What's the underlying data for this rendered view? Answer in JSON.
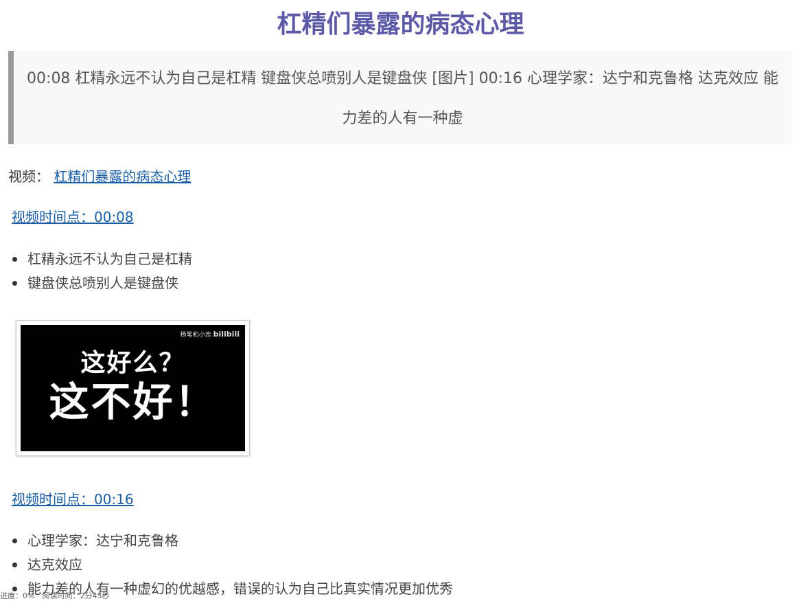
{
  "article": {
    "title": "杠精们暴露的病态心理",
    "summary": "00:08 杠精永远不认为自己是杠精 键盘侠总喷别人是键盘侠 [图片] 00:16 心理学家：达宁和克鲁格 达克效应 能力差的人有一种虚",
    "video_label": "视频：",
    "video_link": "杠精们暴露的病态心理"
  },
  "sections": [
    {
      "timestamp_link": "视频时间点：00:08",
      "bullets": [
        "杠精永远不认为自己是杠精",
        "键盘侠总喷别人是键盘侠"
      ],
      "thumbnail": {
        "line1": "这好么？",
        "line2": "这不好！",
        "watermark": "杨笔和小忠",
        "logo": "bilibili"
      }
    },
    {
      "timestamp_link": "视频时间点：00:16",
      "bullets": [
        "心理学家：达宁和克鲁格",
        "达克效应",
        "能力差的人有一种虚幻的优越感，错误的认为自己比真实情况更加优秀"
      ]
    }
  ],
  "footer": {
    "progress": "进度：0%　阅读时间：2分45秒"
  },
  "colors": {
    "title": "#5c5aa6",
    "link": "#1a5fa8",
    "quote_border": "#999999",
    "quote_bg": "#f8f8f8"
  }
}
